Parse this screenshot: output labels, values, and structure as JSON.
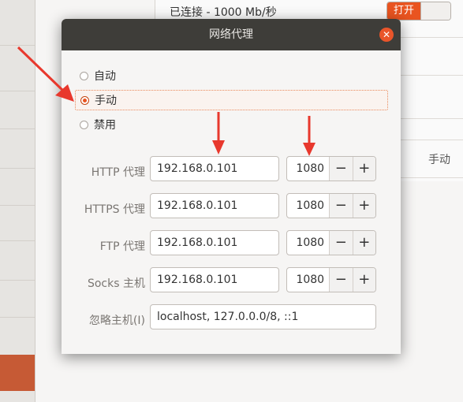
{
  "background": {
    "status_text": "已连接 - 1000 Mb/秒",
    "switch_label": "打开",
    "proxy_mode_text": "手动"
  },
  "dialog": {
    "title": "网络代理",
    "close_icon": "close-icon",
    "modes": [
      {
        "label": "自动",
        "selected": false
      },
      {
        "label": "手动",
        "selected": true
      },
      {
        "label": "禁用",
        "selected": false
      }
    ],
    "proxies": [
      {
        "label": "HTTP 代理",
        "host": "192.168.0.101",
        "port": "1080"
      },
      {
        "label": "HTTPS 代理",
        "host": "192.168.0.101",
        "port": "1080"
      },
      {
        "label": "FTP 代理",
        "host": "192.168.0.101",
        "port": "1080"
      },
      {
        "label": "Socks 主机",
        "host": "192.168.0.101",
        "port": "1080"
      }
    ],
    "ignore": {
      "label": "忽略主机(I)",
      "value": "localhost, 127.0.0.0/8, ::1"
    },
    "spin_minus": "−",
    "spin_plus": "+"
  },
  "colors": {
    "accent": "#e95420",
    "annotation": "#e8382d",
    "titlebar": "#3e3d39"
  }
}
